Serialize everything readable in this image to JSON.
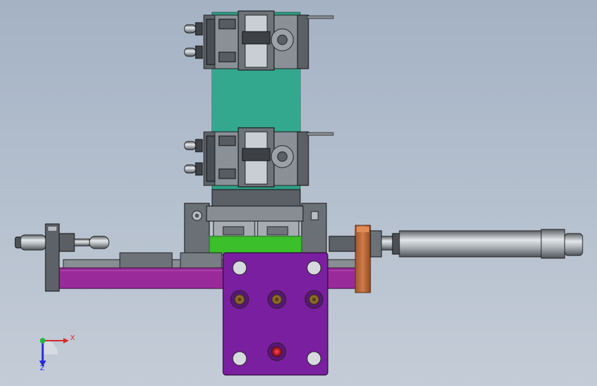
{
  "viewport": {
    "background_top": "#a4b2c4",
    "background_bottom": "#c4ccd7"
  },
  "axis_triad": {
    "x_label": "X",
    "z_label": "Z",
    "x_color": "#d42a2a",
    "y_color": "#2bb14a",
    "z_color": "#2a2ad8"
  },
  "colors": {
    "teal_body": "#2f9e86",
    "purple_plate": "#7a1fa0",
    "magenta_rail": "#9a2a9a",
    "green_block": "#3bbf2a",
    "copper_stop": "#c07040",
    "steel_dark": "#4a4f55",
    "steel_mid": "#7c8289",
    "steel_light": "#b9bec4"
  },
  "icons": {
    "triad": "axis-triad-icon"
  }
}
